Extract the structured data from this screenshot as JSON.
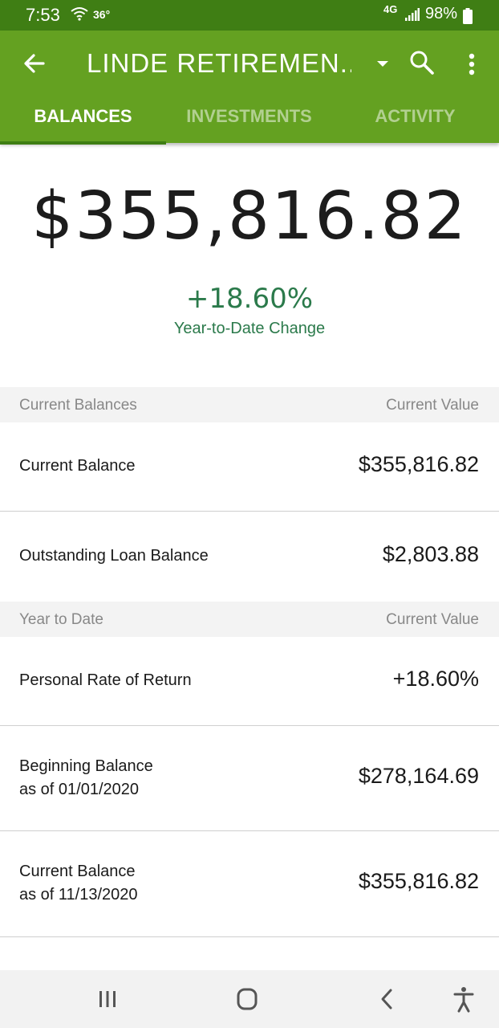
{
  "status_bar": {
    "time": "7:53",
    "temperature": "36°",
    "network": "4G",
    "battery": "98%"
  },
  "app_bar": {
    "title": "LINDE RETIREMEN...",
    "tabs": [
      {
        "label": "BALANCES",
        "active": true
      },
      {
        "label": "INVESTMENTS",
        "active": false
      },
      {
        "label": "ACTIVITY",
        "active": false
      }
    ]
  },
  "hero": {
    "amount": "$355,816.82",
    "change": "+18.60%",
    "change_label": "Year-to-Date Change"
  },
  "sections": [
    {
      "header_left": "Current Balances",
      "header_right": "Current Value",
      "rows": [
        {
          "label": "Current Balance",
          "sublabel": "",
          "value": "$355,816.82"
        },
        {
          "label": "Outstanding Loan Balance",
          "sublabel": "",
          "value": "$2,803.88"
        }
      ]
    },
    {
      "header_left": "Year to Date",
      "header_right": "Current Value",
      "rows": [
        {
          "label": "Personal Rate of Return",
          "sublabel": "",
          "value": "+18.60%"
        },
        {
          "label": "Beginning Balance",
          "sublabel": "as of 01/01/2020",
          "value": "$278,164.69"
        },
        {
          "label": "Current Balance",
          "sublabel": "as of 11/13/2020",
          "value": "$355,816.82"
        }
      ]
    }
  ],
  "colors": {
    "status_bar": "#3f7e14",
    "app_bar": "#64a121",
    "positive_change": "#2b7a4b"
  },
  "icons": {
    "back": "arrow-left-icon",
    "dropdown": "caret-down-icon",
    "search": "search-icon",
    "more": "more-vertical-icon",
    "nav_recents": "recent-apps-icon",
    "nav_home": "home-icon",
    "nav_back": "chevron-left-icon",
    "nav_accessibility": "accessibility-icon"
  }
}
